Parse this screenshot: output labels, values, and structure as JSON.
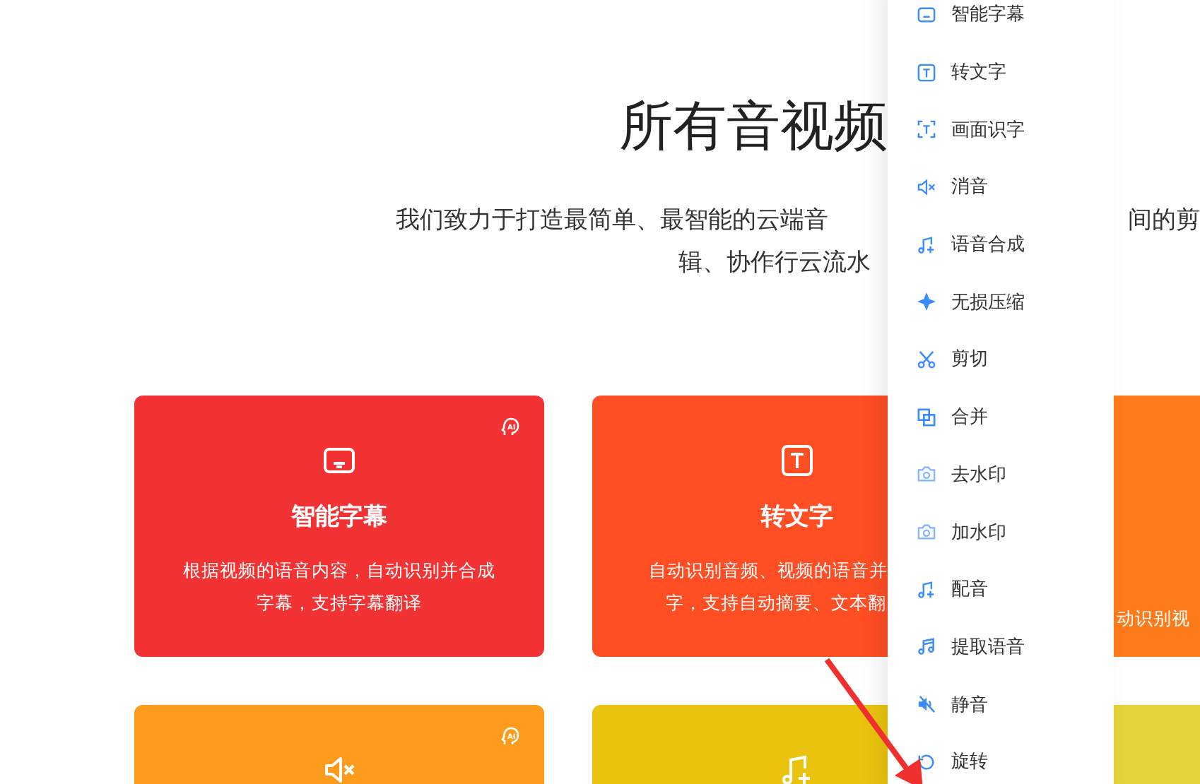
{
  "hero": {
    "title": "所有音视频",
    "subtitle_line_1_left": "我们致力于打造最简单、最智能的云端音",
    "subtitle_line_1_right": "间的剪",
    "subtitle_line_2": "辑、协作行云流水"
  },
  "cards": [
    {
      "color": "#f23233",
      "badge": "AI",
      "title": "智能字幕",
      "description": [
        "根据视频的语音内容，自动识别并合成",
        "字幕，支持字幕翻译"
      ]
    },
    {
      "color": "#ff4d24",
      "title": "转文字",
      "description": [
        "自动识别音频、视频的语音并",
        "字，支持自动摘要、文本翻"
      ]
    },
    {
      "color": "#fd7b1a",
      "description": [
        "动识别视"
      ]
    },
    {
      "color": "#fd9c1c",
      "badge": "AI"
    },
    {
      "color": "#e9c30e"
    },
    {
      "color": "#e4d33a"
    }
  ],
  "menu": {
    "items": [
      {
        "label": "智能字幕"
      },
      {
        "label": "转文字"
      },
      {
        "label": "画面识字"
      },
      {
        "label": "消音"
      },
      {
        "label": "语音合成"
      },
      {
        "label": "无损压缩"
      },
      {
        "label": "剪切"
      },
      {
        "label": "合并"
      },
      {
        "label": "去水印"
      },
      {
        "label": "加水印"
      },
      {
        "label": "配音"
      },
      {
        "label": "提取语音"
      },
      {
        "label": "静音"
      },
      {
        "label": "旋转"
      }
    ]
  }
}
